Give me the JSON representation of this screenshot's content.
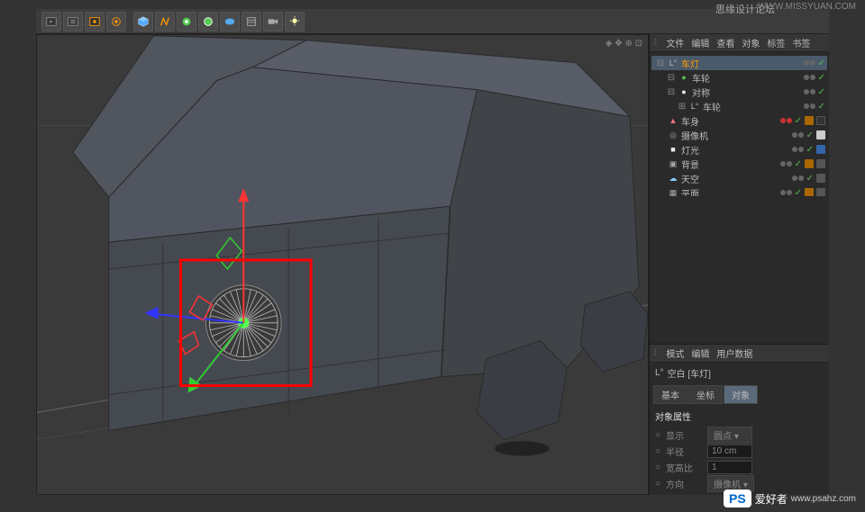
{
  "watermarks": {
    "top_left": "思缘设计论坛",
    "top_url": "WWW.MISSYUAN.COM",
    "ps_badge": "PS",
    "ps_text": "爱好者",
    "ps_url": "www.psahz.com"
  },
  "toolbar_icons": [
    "render-icon",
    "render-region-icon",
    "render-active-icon",
    "render-settings-icon",
    "cube-icon",
    "brush-icon",
    "deformer-icon",
    "generator-icon",
    "environment-icon",
    "camera-icon",
    "light-icon"
  ],
  "viewport": {
    "nav_icons": "◈ ✥ ⊕ ⊡"
  },
  "obj_panel": {
    "tabs": [
      "文件",
      "编辑",
      "查看",
      "对象",
      "标签",
      "书签"
    ],
    "items": [
      {
        "indent": 0,
        "expand": "⊟",
        "icon": "L°",
        "label": "车灯",
        "color": "orange",
        "vis": "gg",
        "check": true,
        "tags": []
      },
      {
        "indent": 1,
        "expand": "⊟",
        "icon": "●",
        "iconColor": "#5b5",
        "label": "车轮",
        "vis": "gg",
        "check": true,
        "tags": []
      },
      {
        "indent": 1,
        "expand": "⊟",
        "icon": "●",
        "iconColor": "#eee",
        "label": "对称",
        "vis": "gg",
        "check": true,
        "tags": []
      },
      {
        "indent": 2,
        "expand": "⊞",
        "icon": "L°",
        "label": "车轮",
        "vis": "gg",
        "check": true,
        "tags": []
      },
      {
        "indent": 0,
        "expand": "",
        "icon": "▲",
        "iconColor": "#e77",
        "label": "车身",
        "vis": "rr",
        "check": true,
        "tags": [
          "orange",
          "dark"
        ]
      },
      {
        "indent": 0,
        "expand": "",
        "icon": "◎",
        "iconColor": "#aaa",
        "label": "摄像机",
        "vis": "gg",
        "check": true,
        "tags": [
          "white"
        ]
      },
      {
        "indent": 0,
        "expand": "",
        "icon": "■",
        "iconColor": "#eee",
        "label": "灯光",
        "vis": "gg",
        "check": true,
        "tags": [
          "blue"
        ]
      },
      {
        "indent": 0,
        "expand": "",
        "icon": "▣",
        "iconColor": "#aaa",
        "label": "背景",
        "vis": "gg",
        "check": true,
        "tags": [
          "orange",
          "gray"
        ]
      },
      {
        "indent": 0,
        "expand": "",
        "icon": "☁",
        "iconColor": "#8cf",
        "label": "天空",
        "vis": "gg",
        "check": true,
        "tags": [
          "gray"
        ]
      },
      {
        "indent": 0,
        "expand": "",
        "icon": "▦",
        "iconColor": "#aaa",
        "label": "平面",
        "vis": "gg",
        "check": true,
        "tags": [
          "orange",
          "gray"
        ]
      }
    ]
  },
  "attr_panel": {
    "tabs": [
      "模式",
      "编辑",
      "用户数据"
    ],
    "object_icon": "L°",
    "object_name": "空白 [车灯]",
    "subtabs": [
      "基本",
      "坐标",
      "对象"
    ],
    "active_subtab": "对象",
    "section_title": "对象属性",
    "rows": [
      {
        "label": "显示",
        "value": "圆点",
        "type": "dropdown"
      },
      {
        "label": "半径",
        "value": "10 cm",
        "type": "input"
      },
      {
        "label": "宽高比",
        "value": "1",
        "type": "input"
      },
      {
        "label": "方向",
        "value": "摄像机",
        "type": "dropdown"
      }
    ]
  }
}
